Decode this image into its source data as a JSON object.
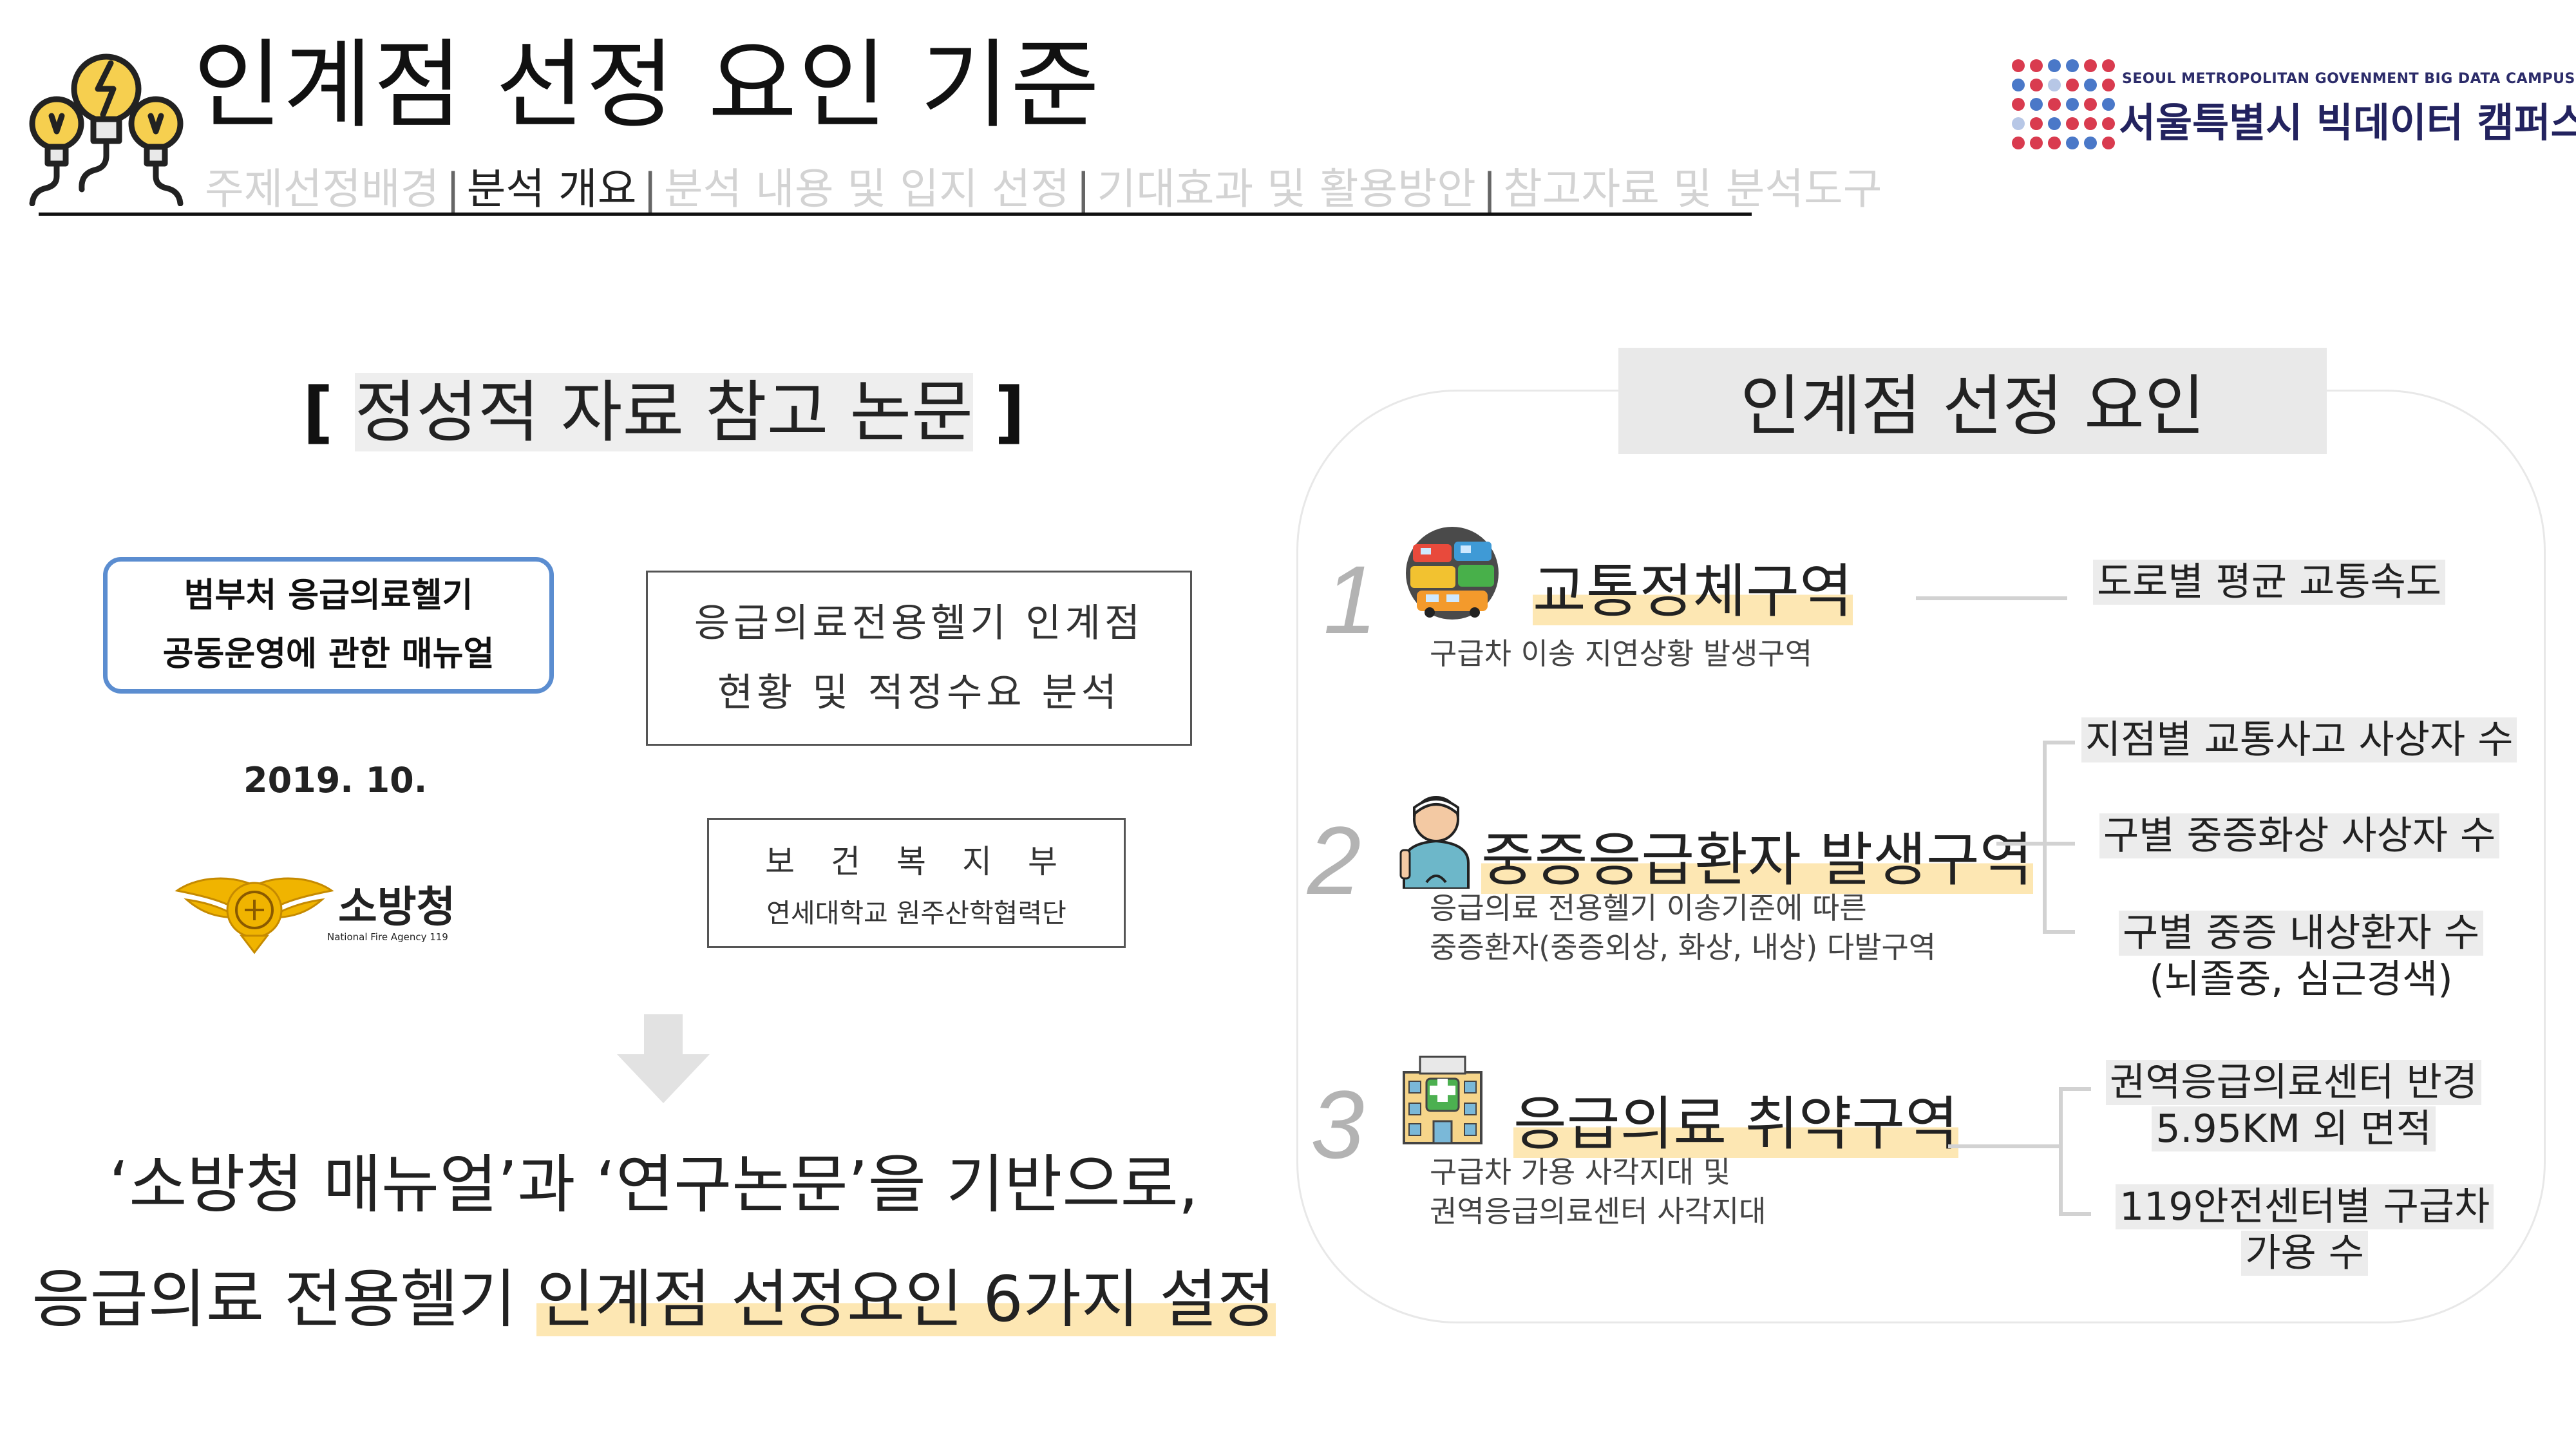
{
  "header": {
    "title": "인계점 선정 요인 기준",
    "nav": [
      {
        "label": "주제선정배경",
        "active": false
      },
      {
        "label": "분석 개요",
        "active": true
      },
      {
        "label": "분석 내용 및 입지 선정",
        "active": false
      },
      {
        "label": "기대효과 및 활용방안",
        "active": false
      },
      {
        "label": "참고자료 및 분석도구",
        "active": false
      }
    ],
    "separator": "|"
  },
  "logo": {
    "en": "SEOUL METROPOLITAN GOVENMENT BIG DATA CAMPUS",
    "ko": "서울특별시 빅데이터 캠퍼스",
    "dot_colors": [
      "#d93b4f",
      "#4a78c8",
      "#b7c7e6"
    ]
  },
  "left": {
    "heading": "정성적 자료 참고 논문",
    "bracket_open": "[",
    "bracket_close": "]",
    "manual": {
      "line1": "범부처 응급의료헬기",
      "line2": "공동운영에 관한 매뉴얼",
      "date": "2019. 10.",
      "org": "소방청",
      "org_en": "National Fire Agency 119"
    },
    "paper": {
      "line1": "응급의료전용헬기 인계점",
      "line2": "현황 및 적정수요 분석"
    },
    "paper_org": {
      "line1": "보건복지부",
      "line2": "연세대학교 원주산학협력단"
    },
    "conclusion": {
      "line1": "‘소방청 매뉴얼’과 ‘연구논문’을 기반으로,",
      "line2_plain": "응급의료 전용헬기 ",
      "line2_hl": "인계점 선정요인 6가지 설정"
    }
  },
  "right": {
    "title": "인계점 선정 요인",
    "factors": [
      {
        "number": "1",
        "icon": "traffic-jam-icon",
        "title": "교통정체구역",
        "desc": [
          "구급차 이송 지연상황 발생구역"
        ],
        "indicators": [
          "도로별 평균 교통속도"
        ]
      },
      {
        "number": "2",
        "icon": "patient-icon",
        "title": "중증응급환자 발생구역",
        "desc": [
          "응급의료 전용헬기 이송기준에 따른",
          "중증환자(중증외상, 화상, 내상) 다발구역"
        ],
        "indicators": [
          "지점별 교통사고 사상자 수",
          "구별 중증화상 사상자 수",
          "구별 중증 내상환자 수",
          "(뇌졸중, 심근경색)"
        ]
      },
      {
        "number": "3",
        "icon": "hospital-icon",
        "title": "응급의료 취약구역",
        "desc": [
          "구급차 가용 사각지대 및",
          "권역응급의료센터 사각지대"
        ],
        "indicators": [
          "권역응급의료센터 반경",
          "5.95KM 외 면적",
          "119안전센터별 구급차",
          "가용 수"
        ]
      }
    ]
  }
}
